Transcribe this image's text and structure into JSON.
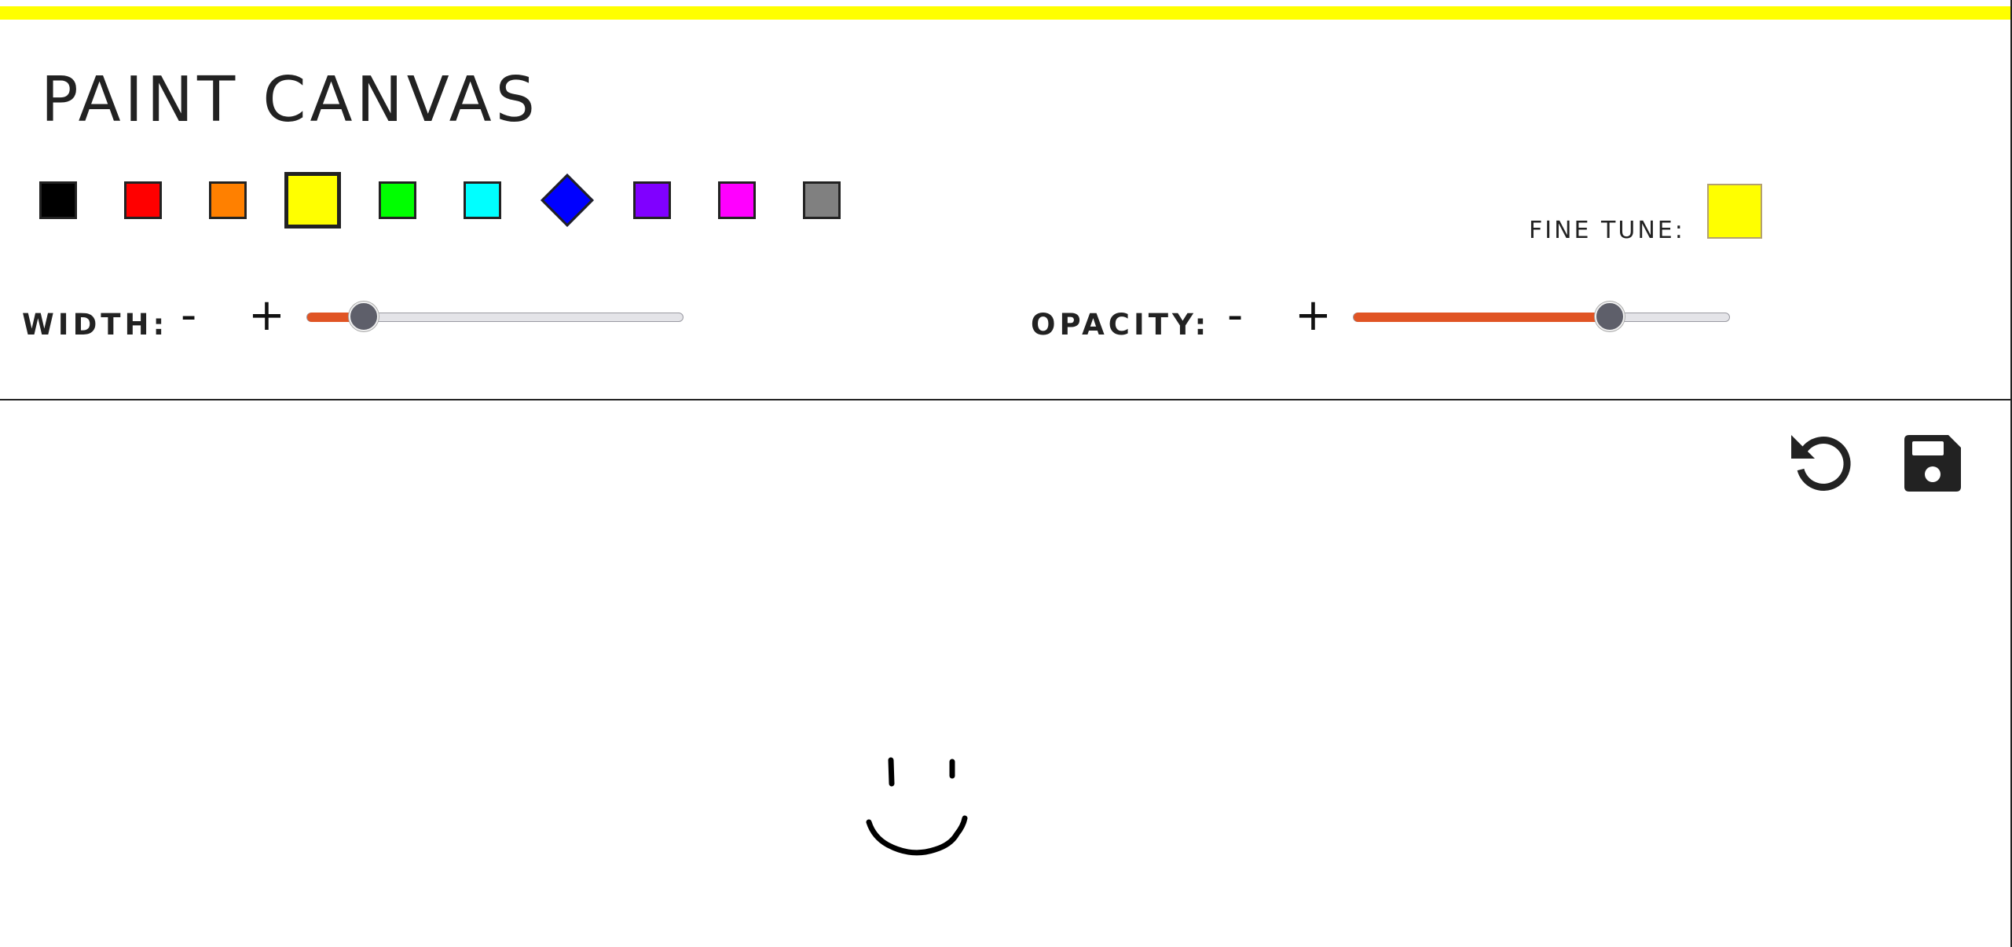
{
  "app": {
    "title": "PAINT CANVAS",
    "accent_bar_color": "#ffff00"
  },
  "palette": {
    "selected_color": "yellow",
    "colors": [
      {
        "name": "black",
        "hex": "#000000"
      },
      {
        "name": "red",
        "hex": "#ff0000"
      },
      {
        "name": "orange",
        "hex": "#ff8000"
      },
      {
        "name": "yellow",
        "hex": "#ffff00"
      },
      {
        "name": "green",
        "hex": "#00ff00"
      },
      {
        "name": "cyan",
        "hex": "#00ffff"
      },
      {
        "name": "blue",
        "hex": "#0000ff"
      },
      {
        "name": "purple",
        "hex": "#8000ff"
      },
      {
        "name": "magenta",
        "hex": "#ff00ff"
      },
      {
        "name": "gray",
        "hex": "#808080"
      }
    ]
  },
  "fine_tune": {
    "label": "FINE TUNE:",
    "value": "#ffff00"
  },
  "width_control": {
    "label": "WIDTH:",
    "minus": "-",
    "plus": "+",
    "value_fraction": 0.15
  },
  "opacity_control": {
    "label": "OPACITY:",
    "minus": "-",
    "plus": "+",
    "value_fraction": 0.68
  },
  "toolbar": {
    "undo_icon": "undo-icon",
    "save_icon": "save-icon"
  },
  "drawing": {
    "description_color": "#000000"
  },
  "colors": {
    "slider_fill": "#e05424",
    "slider_thumb": "#5e5f6a",
    "text": "#222222"
  }
}
